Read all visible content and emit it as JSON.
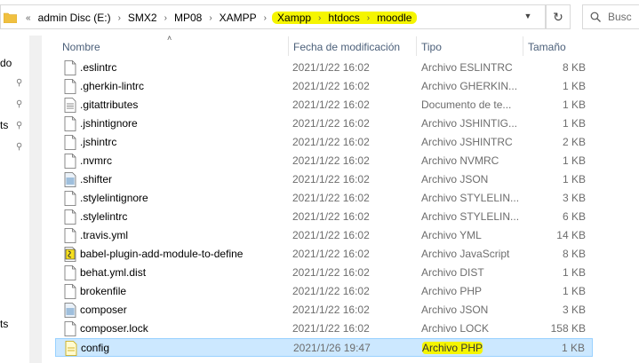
{
  "address_bar": {
    "overflow": "«",
    "segments": [
      "admin Disc (E:)",
      "SMX2",
      "MP08",
      "XAMPP",
      "Xampp",
      "htdocs",
      "moodle"
    ],
    "highlighted_from_index": 4
  },
  "search": {
    "placeholder": "Busc"
  },
  "nav": {
    "labels": [
      "do",
      "ts",
      "ts"
    ]
  },
  "columns": {
    "name": "Nombre",
    "date": "Fecha de modificación",
    "type": "Tipo",
    "size": "Tamaño"
  },
  "files": [
    {
      "name": ".eslintrc",
      "date": "2021/1/22 16:02",
      "type": "Archivo ESLINTRC",
      "size": "8 KB",
      "icon": "file-icon"
    },
    {
      "name": ".gherkin-lintrc",
      "date": "2021/1/22 16:02",
      "type": "Archivo GHERKIN...",
      "size": "1 KB",
      "icon": "file-icon"
    },
    {
      "name": ".gitattributes",
      "date": "2021/1/22 16:02",
      "type": "Documento de te...",
      "size": "1 KB",
      "icon": "text-file-icon"
    },
    {
      "name": ".jshintignore",
      "date": "2021/1/22 16:02",
      "type": "Archivo JSHINTIG...",
      "size": "1 KB",
      "icon": "file-icon"
    },
    {
      "name": ".jshintrc",
      "date": "2021/1/22 16:02",
      "type": "Archivo JSHINTRC",
      "size": "2 KB",
      "icon": "file-icon"
    },
    {
      "name": ".nvmrc",
      "date": "2021/1/22 16:02",
      "type": "Archivo NVMRC",
      "size": "1 KB",
      "icon": "file-icon"
    },
    {
      "name": ".shifter",
      "date": "2021/1/22 16:02",
      "type": "Archivo JSON",
      "size": "1 KB",
      "icon": "json-file-icon"
    },
    {
      "name": ".stylelintignore",
      "date": "2021/1/22 16:02",
      "type": "Archivo STYLELIN...",
      "size": "3 KB",
      "icon": "file-icon"
    },
    {
      "name": ".stylelintrc",
      "date": "2021/1/22 16:02",
      "type": "Archivo STYLELIN...",
      "size": "6 KB",
      "icon": "file-icon"
    },
    {
      "name": ".travis.yml",
      "date": "2021/1/22 16:02",
      "type": "Archivo YML",
      "size": "14 KB",
      "icon": "file-icon"
    },
    {
      "name": "babel-plugin-add-module-to-define",
      "date": "2021/1/22 16:02",
      "type": "Archivo JavaScript",
      "size": "8 KB",
      "icon": "js-file-icon"
    },
    {
      "name": "behat.yml.dist",
      "date": "2021/1/22 16:02",
      "type": "Archivo DIST",
      "size": "1 KB",
      "icon": "file-icon"
    },
    {
      "name": "brokenfile",
      "date": "2021/1/22 16:02",
      "type": "Archivo PHP",
      "size": "1 KB",
      "icon": "file-icon"
    },
    {
      "name": "composer",
      "date": "2021/1/22 16:02",
      "type": "Archivo JSON",
      "size": "3 KB",
      "icon": "json-file-icon"
    },
    {
      "name": "composer.lock",
      "date": "2021/1/22 16:02",
      "type": "Archivo LOCK",
      "size": "158 KB",
      "icon": "file-icon"
    },
    {
      "name": "config",
      "date": "2021/1/26 19:47",
      "type": "Archivo PHP",
      "size": "1 KB",
      "icon": "php-file-icon",
      "selected": true
    }
  ],
  "colors": {
    "highlight": "#f5f500",
    "selection": "#cce8ff",
    "header_text": "#4c607a"
  }
}
